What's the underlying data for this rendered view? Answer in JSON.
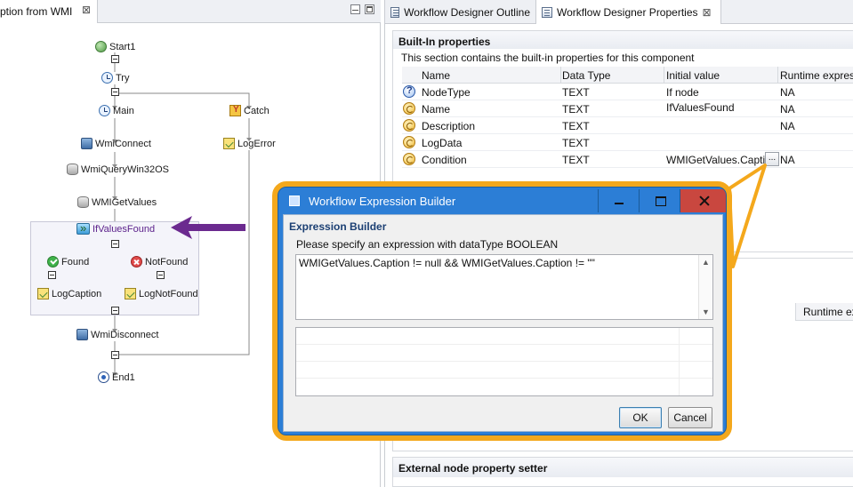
{
  "editor": {
    "tab_label": "ption from WMI",
    "tab_close": "⊠"
  },
  "workflow": {
    "nodes": {
      "start": "Start1",
      "try": "Try",
      "main": "Main",
      "catch": "Catch",
      "wmi_connect": "WmiConnect",
      "log_error": "LogError",
      "wmi_query": "WmiQueryWin32OS",
      "wmi_get_values": "WMIGetValues",
      "if_values_found": "IfValuesFound",
      "found": "Found",
      "not_found": "NotFound",
      "log_caption": "LogCaption",
      "log_not_found": "LogNotFound",
      "wmi_disconnect": "WmiDisconnect",
      "end": "End1"
    }
  },
  "right_tabs": {
    "outline": "Workflow Designer Outline",
    "properties": "Workflow Designer Properties",
    "properties_close": "⊠"
  },
  "builtin": {
    "title": "Built-In properties",
    "description": "This section contains the built-in properties for this component",
    "columns": [
      "Name",
      "Data Type",
      "Initial value",
      "Runtime expressi"
    ],
    "rows": [
      {
        "icon": "help-icon",
        "name": "NodeType",
        "type": "TEXT",
        "initial": "If node",
        "runtime": "NA"
      },
      {
        "icon": "property-icon",
        "name": "Name",
        "type": "TEXT",
        "initial": "IfValuesFound",
        "runtime": "NA"
      },
      {
        "icon": "property-icon",
        "name": "Description",
        "type": "TEXT",
        "initial": "",
        "runtime": "NA"
      },
      {
        "icon": "property-icon",
        "name": "LogData",
        "type": "TEXT",
        "initial": "",
        "runtime": ""
      },
      {
        "icon": "property-icon",
        "name": "Condition",
        "type": "TEXT",
        "initial": "WMIGetValues.Capti",
        "runtime": "NA"
      }
    ],
    "ellipsis_label": "..."
  },
  "lower_table": {
    "runtime_header": "Runtime ex"
  },
  "external": {
    "title": "External node property setter"
  },
  "dialog": {
    "title": "Workflow Expression Builder",
    "section_title": "Expression Builder",
    "prompt": "Please specify an expression with dataType BOOLEAN",
    "expression": "WMIGetValues.Caption != null && WMIGetValues.Caption != \"\"",
    "scroll_up": "▲",
    "scroll_down": "▼",
    "ok_label": "OK",
    "cancel_label": "Cancel"
  },
  "colors": {
    "callout": "#f4a81c",
    "arrow": "#6b2a8f",
    "dialog_title": "#2c7ed6",
    "close_button": "#c9473f"
  }
}
